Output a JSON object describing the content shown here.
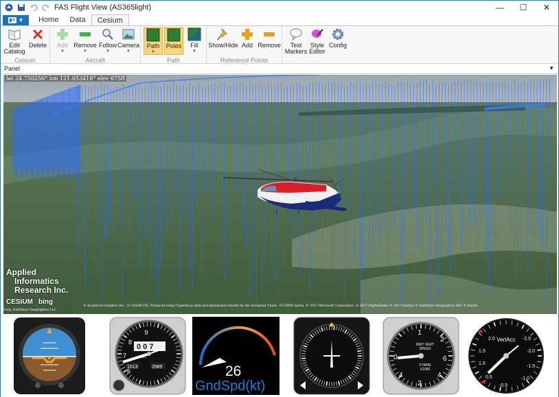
{
  "window": {
    "title": "FAS Flight View (AS365light)",
    "controls": {
      "minimize": "—",
      "maximize": "☐",
      "close": "✕"
    }
  },
  "tabs": [
    "Home",
    "Data",
    "Cesium"
  ],
  "active_tab": "Cesium",
  "ribbon": {
    "groups": {
      "cesium": "Cesium",
      "aircraft": "Aircraft",
      "path": "Path",
      "reference_points": "Reference Points"
    },
    "buttons": {
      "edit_catalog_1": "Edit",
      "edit_catalog_2": "Catalog",
      "delete": "Delete",
      "add_aircraft": "Add",
      "remove_aircraft": "Remove",
      "follow": "Follow",
      "camera": "Camera",
      "path": "Path",
      "poles": "Poles",
      "fill": "Fill",
      "show_hide": "Show/Hide",
      "add_ref": "Add",
      "remove_ref": "Remove",
      "text_markers_1": "Text",
      "text_markers_2": "Markers",
      "style_editor_1": "Style",
      "style_editor_2": "Editor",
      "config": "Config"
    }
  },
  "panel": {
    "label": "Panel",
    "arrow": "▼"
  },
  "viewport": {
    "coords": "lat 24.750256° lon 121.053418° elev 675ft",
    "brand_lines": [
      "Applied",
      "Informatics",
      "Research Inc."
    ],
    "cesium": "CESIUM",
    "bing": "bing",
    "credits": "© Analytical Graphics Inc., © CGIAR-CSI, Produced using Copernicus data and information funded by the European Union - EU-DEM layers, © 2017 Microsoft Corporation, © 2017 DigitalGlobe © 2017 GeoEye © Earthstar Geographics SIO, © Harris",
    "credits2": "Corp, Earthstar Geographics LLC"
  },
  "instruments": {
    "altimeter": {
      "pressure": "1013",
      "inhg": "2989",
      "label": "ALT"
    },
    "gndspd": {
      "value": "26",
      "label": "GndSpd(kt)"
    },
    "vsi": {
      "title_1": "INST VERT",
      "title_2": "SPEED",
      "units_1": "FT/MIN",
      "units_2": "X1000"
    },
    "vertacc": {
      "label": "VertAcc"
    }
  },
  "colors": {
    "accent": "#1f6fbf",
    "path_blue": "#2a6cff",
    "pressed": "#fbd47b"
  }
}
